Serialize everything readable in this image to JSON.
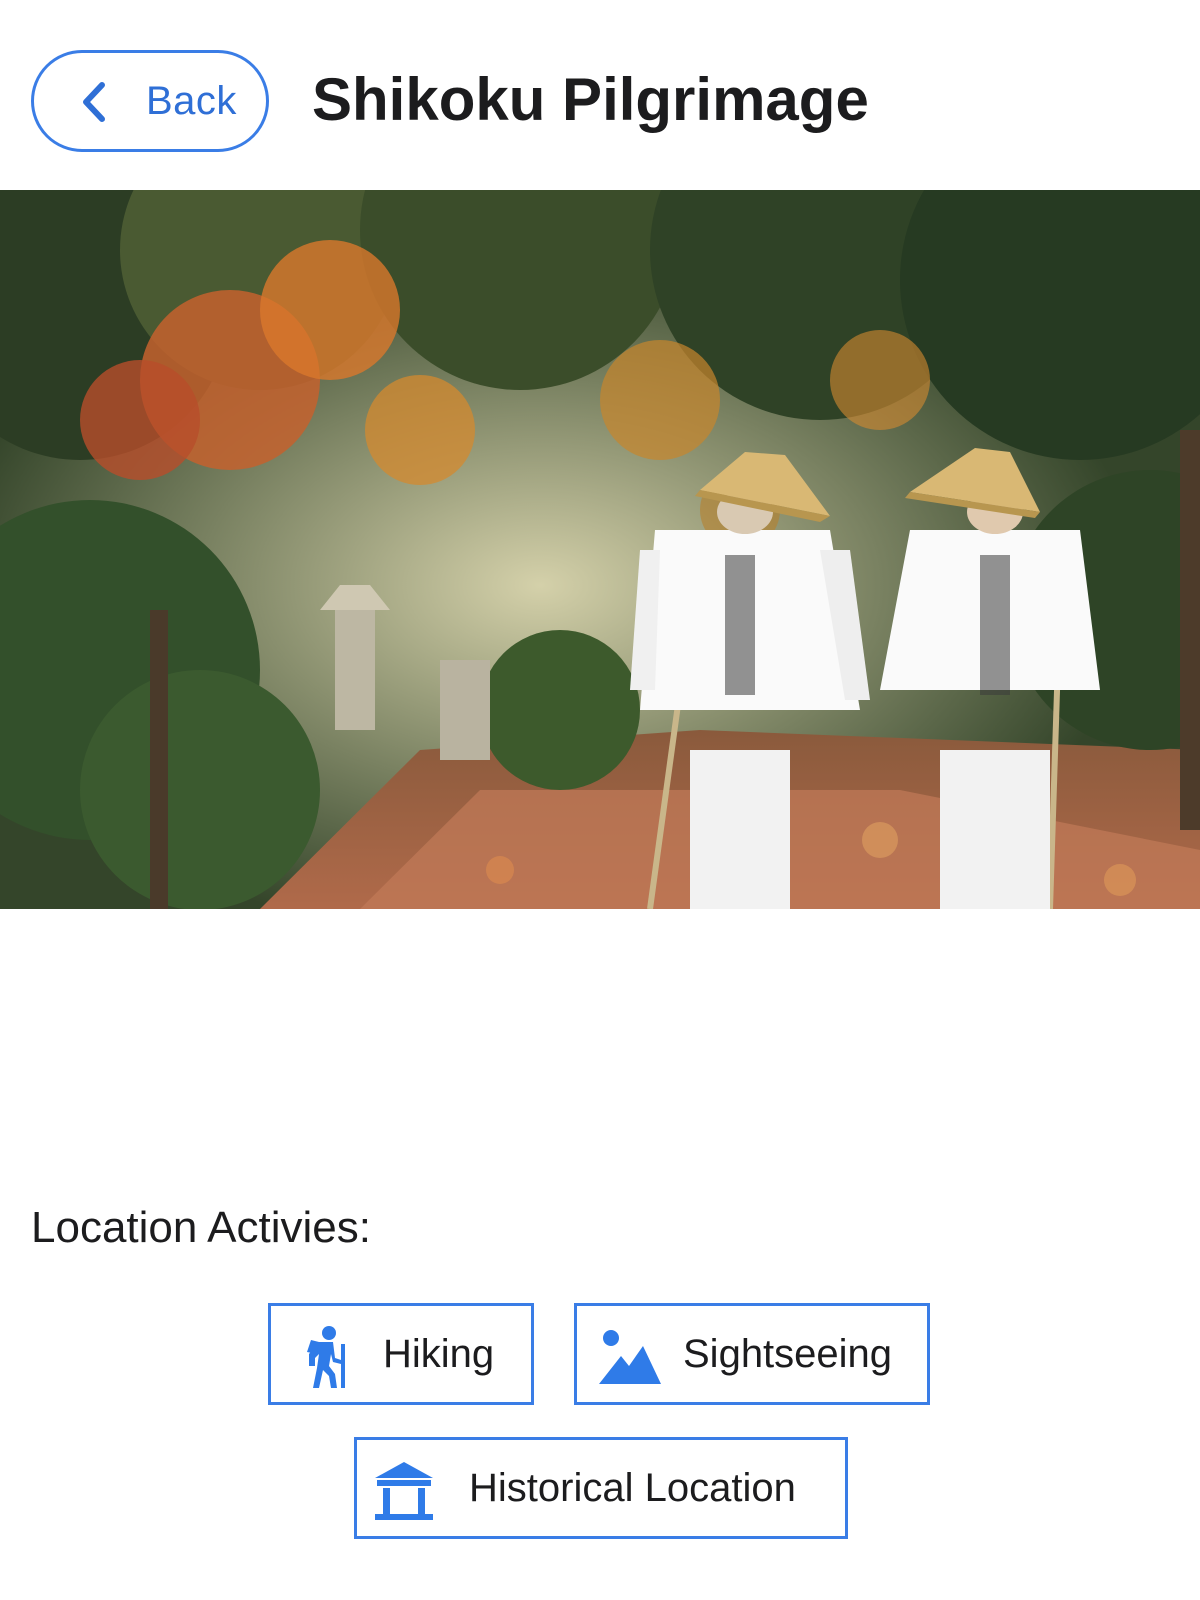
{
  "header": {
    "back_label": "Back",
    "title": "Shikoku Pilgrimage"
  },
  "hero": {
    "description_icon": "photo-two-pilgrims-walking-autumn-path"
  },
  "activities": {
    "heading": "Location Activies:",
    "items": [
      {
        "label": "Hiking",
        "icon": "hiking-icon"
      },
      {
        "label": "Sightseeing",
        "icon": "mountain-landscape-icon"
      },
      {
        "label": "Historical Location",
        "icon": "temple-gate-icon"
      }
    ]
  },
  "colors": {
    "accent": "#3a7de6",
    "back_text": "#2f6fd6",
    "icon": "#2f7be8",
    "text": "#1c1c1e"
  }
}
